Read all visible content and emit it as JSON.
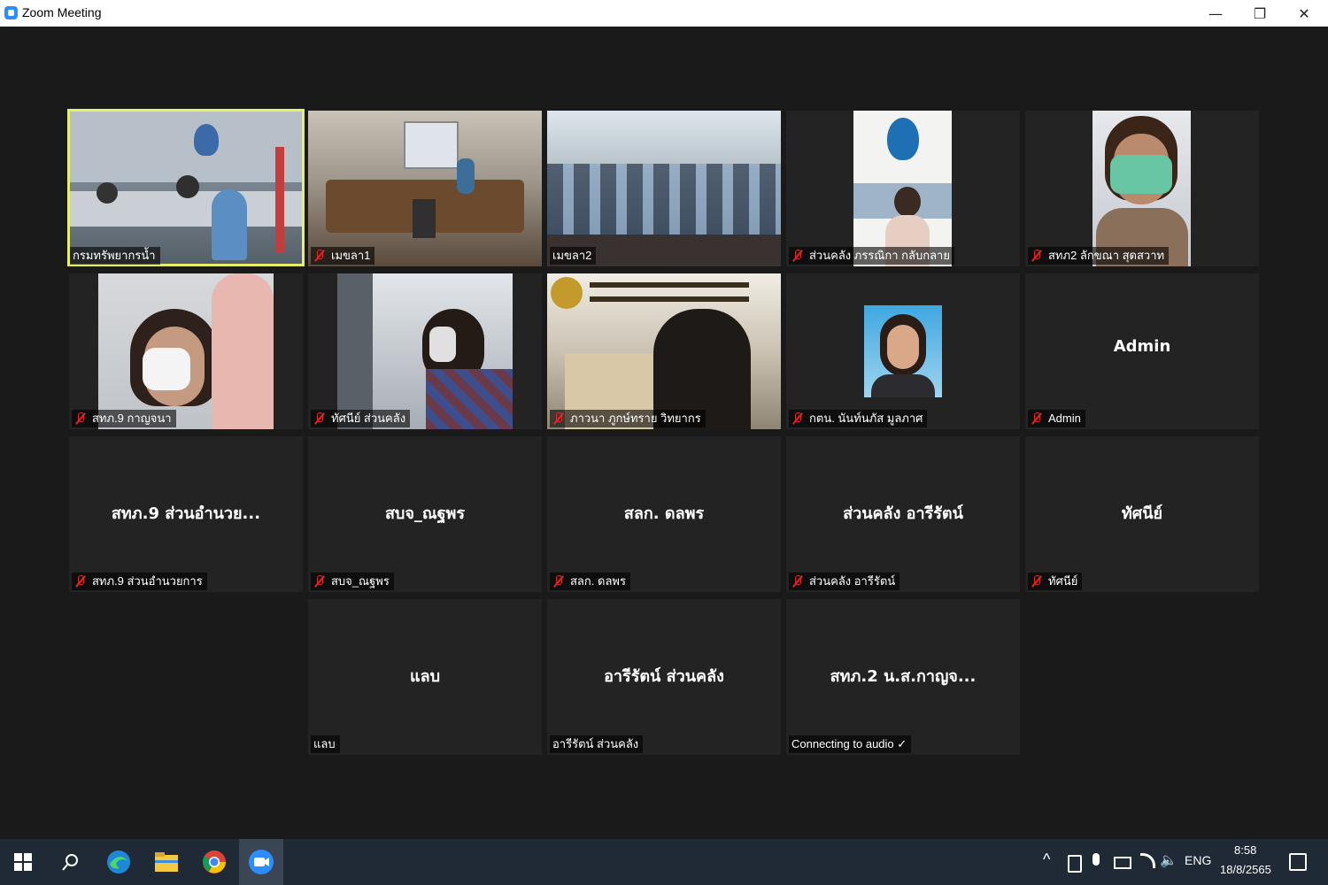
{
  "window": {
    "title": "Zoom Meeting",
    "controls": {
      "minimize": "—",
      "restore": "❐",
      "close": "✕"
    }
  },
  "participants": [
    {
      "label": "กรมทรัพยากรน้ำ",
      "muted": false,
      "video": true,
      "active": true
    },
    {
      "label": "เมขลา1",
      "muted": true,
      "video": true
    },
    {
      "label": "เมขลา2",
      "muted": false,
      "video": true
    },
    {
      "label": "ส่วนคลัง ภรรณิกา กลับกลาย",
      "muted": true,
      "video": true
    },
    {
      "label": "สทภ2 ลักขณา  สุดสวาท",
      "muted": true,
      "video": true
    },
    {
      "label": "สทภ.9 กาญจนา",
      "muted": true,
      "video": true
    },
    {
      "label": "ทัศนีย์ ส่วนคลัง",
      "muted": true,
      "video": true
    },
    {
      "label": "ภาวนา ภูกษ์ทราย วิทยากร",
      "muted": true,
      "video": true
    },
    {
      "label": "กตน. นันท์นภัส มูลภาศ",
      "muted": true,
      "video": true
    },
    {
      "label": "Admin",
      "display_name": "Admin",
      "muted": true,
      "video": false
    },
    {
      "label": "สทภ.9 ส่วนอำนวยการ",
      "display_name": "สทภ.9 ส่วนอำนวย...",
      "muted": true,
      "video": false
    },
    {
      "label": "สบจ_ณฐพร",
      "display_name": "สบจ_ณฐพร",
      "muted": true,
      "video": false
    },
    {
      "label": "สลก. ดลพร",
      "display_name": "สลก. ดลพร",
      "muted": true,
      "video": false
    },
    {
      "label": "ส่วนคลัง อารีรัตน์",
      "display_name": "ส่วนคลัง อารีรัตน์",
      "muted": true,
      "video": false
    },
    {
      "label": "ทัศนีย์",
      "display_name": "ทัศนีย์",
      "muted": true,
      "video": false
    },
    {
      "label": "แลบ",
      "display_name": "แลบ",
      "muted": false,
      "video": false
    },
    {
      "label": "อารีรัตน์ ส่วนคลัง",
      "display_name": "อารีรัตน์ ส่วนคลัง",
      "muted": false,
      "video": false
    },
    {
      "label": "Connecting to audio ✓",
      "display_name": "สทภ.2  น.ส.กาญจ...",
      "muted": false,
      "video": false
    }
  ],
  "taskbar": {
    "apps": [
      "windows-start-icon",
      "search-icon",
      "edge-icon",
      "file-explorer-icon",
      "chrome-icon",
      "zoom-icon"
    ],
    "language": "ENG",
    "time": "8:58",
    "date": "18/8/2565"
  },
  "colors": {
    "active_speaker": "#e7f06a",
    "muted_red": "#e02828",
    "tile_bg": "#232323",
    "stage_bg": "#1a1a1a",
    "taskbar_bg": "#1f2a36"
  }
}
